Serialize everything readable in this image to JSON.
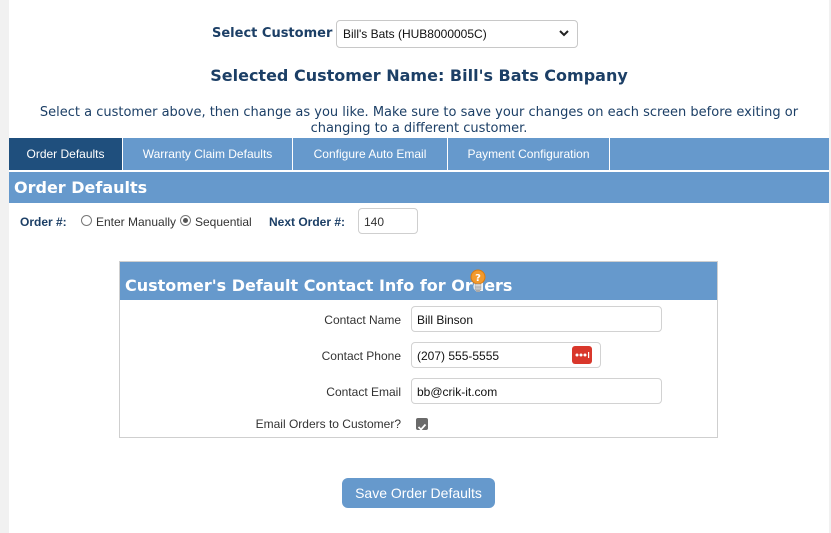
{
  "customer_select": {
    "label": "Select Customer",
    "selected_value": "Bill's Bats (HUB8000005C)"
  },
  "selected_customer_heading": "Selected Customer Name: Bill's Bats Company",
  "intro_text": "Select a customer above, then change as you like. Make sure to save your changes on each screen before exiting or changing to a different customer.",
  "tabs": [
    {
      "label": "Order Defaults",
      "active": true
    },
    {
      "label": "Warranty Claim Defaults",
      "active": false
    },
    {
      "label": "Configure Auto Email",
      "active": false
    },
    {
      "label": "Payment Configuration",
      "active": false
    }
  ],
  "section_title": "Order Defaults",
  "order_number": {
    "label": "Order #:",
    "options": [
      {
        "label": "Enter Manually",
        "checked": false
      },
      {
        "label": "Sequential",
        "checked": true
      }
    ],
    "next_label": "Next Order #:",
    "next_value": "140"
  },
  "contact_info": {
    "title": "Customer's Default Contact Info for Orders",
    "help_icon": "lightbulb-icon",
    "fields": {
      "name": {
        "label": "Contact Name",
        "value": "Bill Binson"
      },
      "phone": {
        "label": "Contact Phone",
        "value": "(207) 555-5555",
        "extension_icon": "password-manager-icon"
      },
      "email": {
        "label": "Contact Email",
        "value": "bb@crik-it.com"
      }
    },
    "email_orders": {
      "label": "Email Orders to Customer?",
      "checked": true
    }
  },
  "save_button_label": "Save Order Defaults",
  "colors": {
    "accent": "#6699cc",
    "active_tab": "#1f4f7d",
    "heading_text": "#1c3f66",
    "extension_button": "#d9372b"
  }
}
